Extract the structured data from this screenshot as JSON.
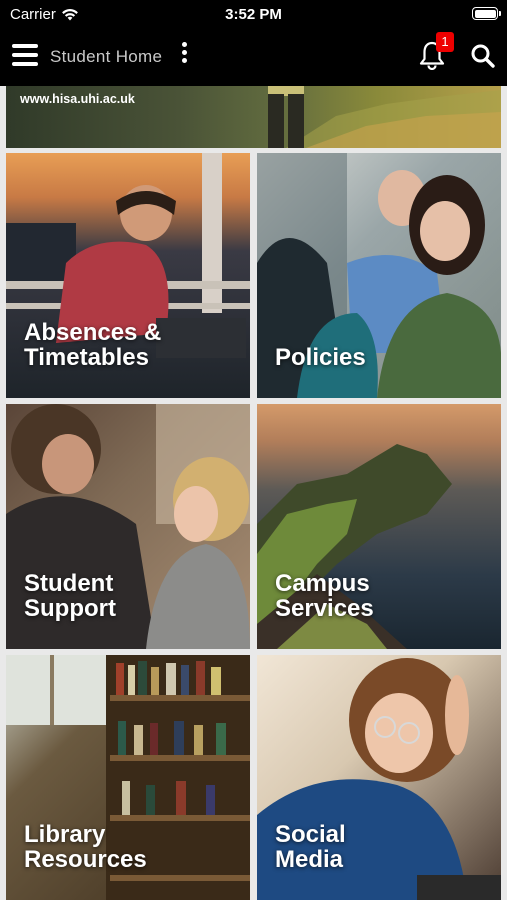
{
  "status_bar": {
    "carrier": "Carrier",
    "time": "3:52 PM"
  },
  "nav": {
    "title": "Student Home",
    "notification_count": "1"
  },
  "banner": {
    "url": "www.hisa.uhi.ac.uk"
  },
  "tiles": [
    {
      "label": "Absences &\nTimetables"
    },
    {
      "label": "Policies"
    },
    {
      "label": "Student\nSupport"
    },
    {
      "label": "Campus\nServices"
    },
    {
      "label": "Library\nResources"
    },
    {
      "label": "Social\nMedia"
    }
  ],
  "colors": {
    "nav_background": "#000000",
    "badge": "#e00000"
  }
}
